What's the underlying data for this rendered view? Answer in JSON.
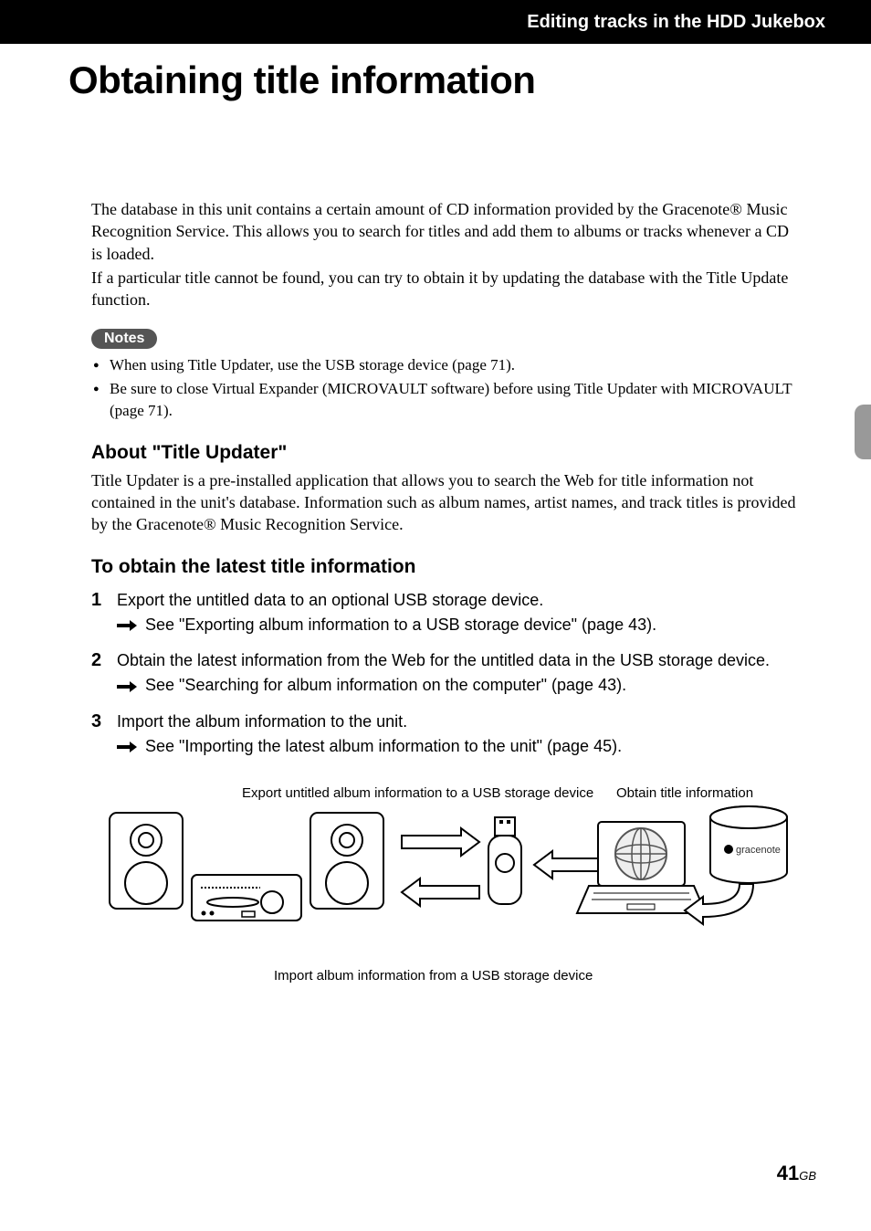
{
  "header": "Editing tracks in the HDD Jukebox",
  "title": "Obtaining title information",
  "intro": {
    "p1": "The database in this unit contains a certain amount of CD information provided by the Gracenote® Music Recognition Service. This allows you to search for titles and add them to albums or tracks whenever a CD is loaded.",
    "p2": "If a particular title cannot be found, you can try to obtain it by updating the database with the Title Update function."
  },
  "notes": {
    "label": "Notes",
    "items": [
      "When using Title Updater, use the USB storage device (page 71).",
      "Be sure to close Virtual Expander (MICROVAULT software) before using Title Updater with MICROVAULT (page 71)."
    ]
  },
  "about": {
    "heading": "About \"Title Updater\"",
    "text": "Title Updater is a pre-installed application that allows you to search the Web for title information not contained in the unit's database. Information such as album names, artist names, and track titles is provided by the Gracenote® Music Recognition Service."
  },
  "obtain": {
    "heading": "To obtain the latest title information",
    "steps": [
      {
        "main": "Export the untitled data to an optional USB storage device.",
        "sub": "See \"Exporting album information to a USB storage device\" (page 43)."
      },
      {
        "main": "Obtain the latest information from the Web for the untitled data in the USB storage device.",
        "sub": "See \"Searching for album information on the computer\" (page 43)."
      },
      {
        "main": "Import the album information to the unit.",
        "sub": "See \"Importing the latest album information to the unit\" (page 45)."
      }
    ]
  },
  "diagram": {
    "label_export": "Export untitled album information to a USB storage device",
    "label_obtain": "Obtain title information",
    "label_import": "Import album information from a USB storage device"
  },
  "page_number": "41",
  "page_suffix": "GB"
}
